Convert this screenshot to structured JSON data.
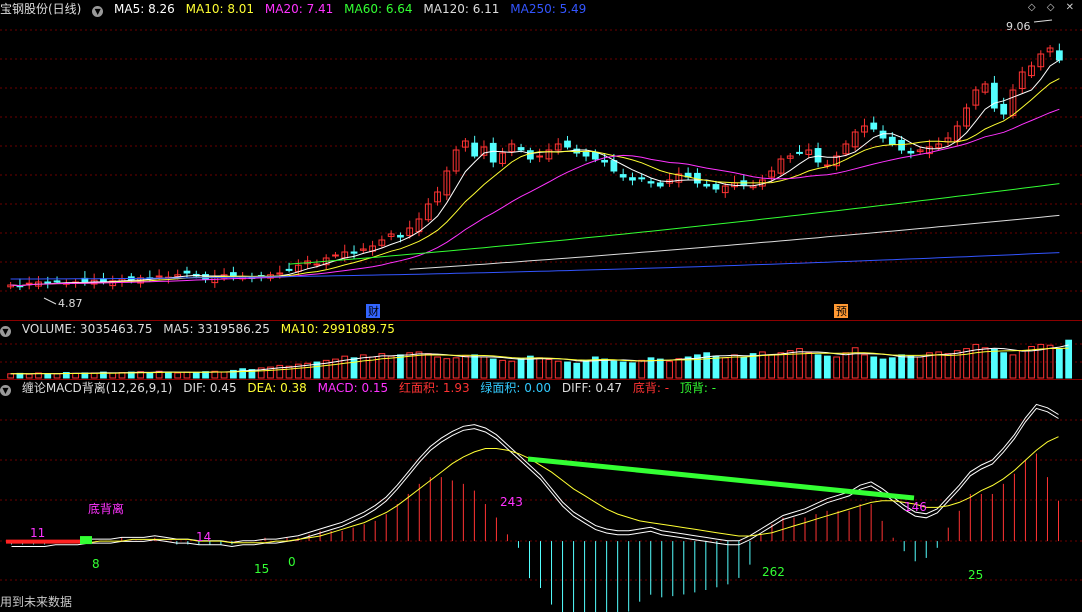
{
  "title": "宝钢股份(日线)",
  "price_header": [
    {
      "label": "MA5: 8.26",
      "color": "#ffffff"
    },
    {
      "label": "MA10: 8.01",
      "color": "#ffff33"
    },
    {
      "label": "MA20: 7.41",
      "color": "#ff33ff"
    },
    {
      "label": "MA60: 6.64",
      "color": "#33ff33"
    },
    {
      "label": "MA120: 6.11",
      "color": "#dddddd"
    },
    {
      "label": "MA250: 5.49",
      "color": "#3355ff"
    }
  ],
  "volume_header": [
    {
      "label": "VOLUME: 3035463.75",
      "color": "#dddddd"
    },
    {
      "label": "MA5: 3319586.25",
      "color": "#dddddd"
    },
    {
      "label": "MA10: 2991089.75",
      "color": "#ffff33"
    }
  ],
  "macd_header": [
    {
      "label": "缠论MACD背离(12,26,9,1)",
      "color": "#dddddd"
    },
    {
      "label": "DIF: 0.45",
      "color": "#dddddd"
    },
    {
      "label": "DEA: 0.38",
      "color": "#ffff33"
    },
    {
      "label": "MACD: 0.15",
      "color": "#ff33ff"
    },
    {
      "label": "红面积: 1.93",
      "color": "#ff3333"
    },
    {
      "label": "绿面积: 0.00",
      "color": "#33ccff"
    },
    {
      "label": "DIFF: 0.47",
      "color": "#dddddd"
    },
    {
      "label": "底背: -",
      "color": "#ff3333"
    },
    {
      "label": "顶背: -",
      "color": "#33ff33"
    }
  ],
  "window_controls": "◇ ◇ ✕",
  "footer_text": "用到未来数据",
  "chart_data": [
    {
      "type": "candlestick",
      "name": "price",
      "max_label": "9.06",
      "min_label": "4.87",
      "event_markers": [
        {
          "label": "财",
          "color": "#3366ff"
        },
        {
          "label": "预",
          "color": "#ff9933"
        }
      ],
      "close_path": [
        4.95,
        4.93,
        4.98,
        5.0,
        4.97,
        5.01,
        4.98,
        5.0,
        4.99,
        5.03,
        5.0,
        5.02,
        5.05,
        5.03,
        5.07,
        5.05,
        5.1,
        5.08,
        5.12,
        5.15,
        5.1,
        5.05,
        5.08,
        5.12,
        5.1,
        5.08,
        5.06,
        5.1,
        5.12,
        5.15,
        5.2,
        5.28,
        5.35,
        5.3,
        5.4,
        5.45,
        5.5,
        5.48,
        5.55,
        5.6,
        5.7,
        5.8,
        5.75,
        5.9,
        6.05,
        6.3,
        6.5,
        6.85,
        7.2,
        7.35,
        7.1,
        7.25,
        7.0,
        7.15,
        7.3,
        7.2,
        7.05,
        7.1,
        7.2,
        7.3,
        7.25,
        7.15,
        7.1,
        7.05,
        7.0,
        6.85,
        6.75,
        6.7,
        6.72,
        6.65,
        6.6,
        6.7,
        6.8,
        6.75,
        6.65,
        6.6,
        6.55,
        6.6,
        6.65,
        6.62,
        6.6,
        6.7,
        6.85,
        7.05,
        7.1,
        7.15,
        7.2,
        7.0,
        6.95,
        7.1,
        7.3,
        7.5,
        7.6,
        7.55,
        7.4,
        7.3,
        7.2,
        7.15,
        7.2,
        7.25,
        7.3,
        7.4,
        7.6,
        7.9,
        8.2,
        8.3,
        7.9,
        7.8,
        8.2,
        8.5,
        8.6,
        8.8,
        8.9,
        8.7
      ]
    },
    {
      "type": "bar",
      "name": "volume",
      "values": [
        0.1,
        0.11,
        0.09,
        0.12,
        0.1,
        0.1,
        0.13,
        0.11,
        0.12,
        0.12,
        0.14,
        0.12,
        0.13,
        0.14,
        0.15,
        0.13,
        0.16,
        0.14,
        0.12,
        0.14,
        0.13,
        0.15,
        0.16,
        0.14,
        0.18,
        0.22,
        0.2,
        0.24,
        0.26,
        0.3,
        0.28,
        0.33,
        0.35,
        0.38,
        0.42,
        0.45,
        0.52,
        0.48,
        0.55,
        0.5,
        0.58,
        0.52,
        0.55,
        0.6,
        0.62,
        0.58,
        0.5,
        0.46,
        0.48,
        0.52,
        0.55,
        0.5,
        0.45,
        0.42,
        0.4,
        0.46,
        0.52,
        0.48,
        0.44,
        0.4,
        0.38,
        0.35,
        0.42,
        0.5,
        0.45,
        0.4,
        0.38,
        0.36,
        0.42,
        0.48,
        0.45,
        0.4,
        0.46,
        0.5,
        0.55,
        0.6,
        0.52,
        0.48,
        0.55,
        0.5,
        0.58,
        0.62,
        0.55,
        0.6,
        0.65,
        0.7,
        0.6,
        0.55,
        0.52,
        0.5,
        0.6,
        0.72,
        0.55,
        0.5,
        0.45,
        0.48,
        0.55,
        0.52,
        0.5,
        0.6,
        0.62,
        0.58,
        0.65,
        0.7,
        0.8,
        0.72,
        0.68,
        0.6,
        0.55,
        0.65,
        0.75,
        0.8,
        0.78,
        0.7,
        0.9
      ]
    },
    {
      "type": "line",
      "name": "macd",
      "annotations": [
        {
          "label": "11",
          "color": "#ff33ff"
        },
        {
          "label": "底背离",
          "color": "#ff33ff"
        },
        {
          "label": "8",
          "color": "#33ff33"
        },
        {
          "label": "14",
          "color": "#ff33ff"
        },
        {
          "label": "15",
          "color": "#33ff33"
        },
        {
          "label": "0",
          "color": "#33ff33"
        },
        {
          "label": "243",
          "color": "#ff33ff"
        },
        {
          "label": "262",
          "color": "#33ff33"
        },
        {
          "label": "146",
          "color": "#ff33ff"
        },
        {
          "label": "25",
          "color": "#33ff33"
        }
      ],
      "dif": [
        -0.02,
        -0.02,
        -0.02,
        -0.02,
        -0.01,
        -0.01,
        -0.01,
        0.0,
        0.0,
        0.0,
        0.01,
        0.01,
        0.01,
        0.02,
        0.01,
        0.0,
        0.0,
        -0.01,
        -0.01,
        -0.01,
        -0.02,
        -0.01,
        -0.01,
        0.0,
        0.0,
        0.01,
        0.02,
        0.04,
        0.06,
        0.08,
        0.1,
        0.13,
        0.16,
        0.2,
        0.25,
        0.32,
        0.4,
        0.48,
        0.55,
        0.6,
        0.64,
        0.67,
        0.68,
        0.66,
        0.62,
        0.56,
        0.5,
        0.44,
        0.38,
        0.3,
        0.22,
        0.16,
        0.12,
        0.08,
        0.06,
        0.05,
        0.05,
        0.06,
        0.07,
        0.05,
        0.04,
        0.03,
        0.02,
        0.01,
        0.0,
        -0.01,
        -0.01,
        0.02,
        0.06,
        0.1,
        0.14,
        0.16,
        0.18,
        0.21,
        0.24,
        0.26,
        0.28,
        0.32,
        0.34,
        0.3,
        0.25,
        0.2,
        0.16,
        0.15,
        0.18,
        0.25,
        0.32,
        0.4,
        0.44,
        0.47,
        0.54,
        0.62,
        0.72,
        0.8,
        0.78,
        0.74
      ],
      "dea": [
        -0.01,
        -0.01,
        -0.01,
        -0.01,
        -0.01,
        -0.01,
        -0.01,
        -0.01,
        0.0,
        0.0,
        0.0,
        0.01,
        0.01,
        0.01,
        0.01,
        0.01,
        0.01,
        0.0,
        0.0,
        0.0,
        -0.01,
        -0.01,
        -0.01,
        -0.01,
        0.0,
        0.0,
        0.01,
        0.02,
        0.03,
        0.05,
        0.07,
        0.09,
        0.11,
        0.14,
        0.17,
        0.21,
        0.26,
        0.31,
        0.36,
        0.41,
        0.46,
        0.5,
        0.53,
        0.55,
        0.55,
        0.54,
        0.52,
        0.49,
        0.45,
        0.41,
        0.36,
        0.31,
        0.27,
        0.23,
        0.19,
        0.16,
        0.14,
        0.12,
        0.11,
        0.1,
        0.09,
        0.08,
        0.07,
        0.06,
        0.05,
        0.04,
        0.03,
        0.03,
        0.04,
        0.05,
        0.07,
        0.09,
        0.11,
        0.13,
        0.15,
        0.17,
        0.19,
        0.21,
        0.23,
        0.24,
        0.24,
        0.23,
        0.22,
        0.2,
        0.2,
        0.21,
        0.23,
        0.26,
        0.3,
        0.33,
        0.37,
        0.42,
        0.48,
        0.54,
        0.59,
        0.62
      ]
    }
  ]
}
